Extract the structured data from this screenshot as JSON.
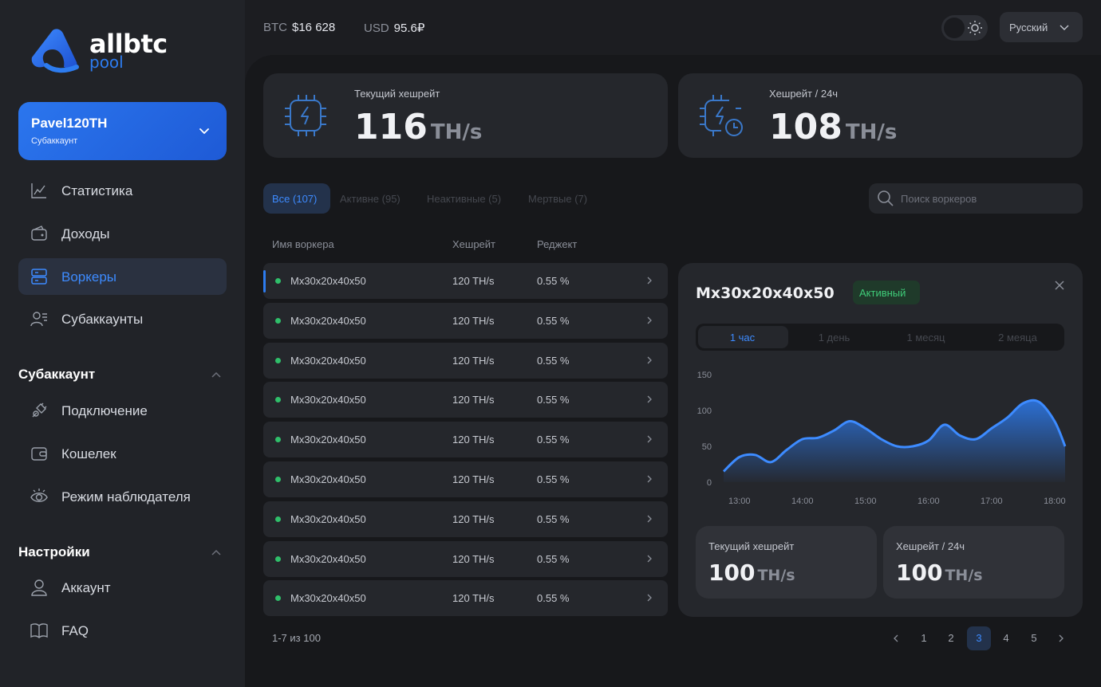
{
  "brand": {
    "name": "allbtc",
    "sub": "pool"
  },
  "account": {
    "name": "Pavel120TH",
    "type": "Субаккаунт"
  },
  "nav": {
    "items": [
      {
        "label": "Статистика",
        "icon": "chart-icon"
      },
      {
        "label": "Доходы",
        "icon": "wallet-icon"
      },
      {
        "label": "Воркеры",
        "icon": "server-icon",
        "active": true
      },
      {
        "label": "Субаккаунты",
        "icon": "users-icon"
      }
    ],
    "sub_section": "Субаккаунт",
    "sub_items": [
      {
        "label": "Подключение",
        "icon": "plug-icon"
      },
      {
        "label": "Кошелек",
        "icon": "wallet-icon"
      },
      {
        "label": "Режим наблюдателя",
        "icon": "eye-icon"
      }
    ],
    "settings_section": "Настройки",
    "settings_items": [
      {
        "label": "Аккаунт",
        "icon": "user-icon"
      },
      {
        "label": "FAQ",
        "icon": "book-icon"
      }
    ]
  },
  "ticker": {
    "btc_label": "BTC",
    "btc_value": "$16 628",
    "usd_label": "USD",
    "usd_value": "95.6₽"
  },
  "language": "Русский",
  "stats": [
    {
      "title": "Текущий хешрейт",
      "value": "116",
      "unit": "TH/s"
    },
    {
      "title": "Хешрейт / 24ч",
      "value": "108",
      "unit": "TH/s"
    }
  ],
  "filters": {
    "all": "Все (107)",
    "active": "Активне (95)",
    "inactive": "Неактивные (5)",
    "dead": "Мертвые (7)"
  },
  "search": {
    "placeholder": "Поиск воркеров"
  },
  "table": {
    "headers": {
      "name": "Имя воркера",
      "hashrate": "Хешрейт",
      "reject": "Реджект"
    },
    "rows": [
      {
        "name": "Mx30x20x40x50",
        "hashrate": "120 TH/s",
        "reject": "0.55 %"
      },
      {
        "name": "Mx30x20x40x50",
        "hashrate": "120 TH/s",
        "reject": "0.55 %"
      },
      {
        "name": "Mx30x20x40x50",
        "hashrate": "120 TH/s",
        "reject": "0.55 %"
      },
      {
        "name": "Mx30x20x40x50",
        "hashrate": "120 TH/s",
        "reject": "0.55 %"
      },
      {
        "name": "Mx30x20x40x50",
        "hashrate": "120 TH/s",
        "reject": "0.55 %"
      },
      {
        "name": "Mx30x20x40x50",
        "hashrate": "120 TH/s",
        "reject": "0.55 %"
      },
      {
        "name": "Mx30x20x40x50",
        "hashrate": "120 TH/s",
        "reject": "0.55 %"
      },
      {
        "name": "Mx30x20x40x50",
        "hashrate": "120 TH/s",
        "reject": "0.55 %"
      },
      {
        "name": "Mx30x20x40x50",
        "hashrate": "120 TH/s",
        "reject": "0.55 %"
      }
    ]
  },
  "pagination": {
    "info": "1-7 из 100",
    "pages": [
      "1",
      "2",
      "3",
      "4",
      "5"
    ],
    "current": "3"
  },
  "detail": {
    "title": "Mx30x20x40x50",
    "status": "Активный",
    "periods": [
      "1 час",
      "1 день",
      "1 месяц",
      "2 меяца"
    ],
    "mini": [
      {
        "title": "Текущий хешрейт",
        "value": "100",
        "unit": "TH/s"
      },
      {
        "title": "Хешрейт / 24ч",
        "value": "100",
        "unit": "TH/s"
      }
    ]
  },
  "colors": {
    "accent": "#2d7cf0",
    "active_green": "#2fbf6a",
    "bg": "#17181b",
    "card": "#25272c"
  },
  "chart_data": {
    "type": "area",
    "x": [
      "12:45",
      "13:00",
      "13:15",
      "13:30",
      "13:45",
      "14:00",
      "14:15",
      "14:30",
      "14:45",
      "15:00",
      "15:15",
      "15:30",
      "15:45",
      "16:00",
      "16:15",
      "16:30",
      "16:45",
      "17:00",
      "17:15",
      "17:30",
      "17:45",
      "18:00",
      "18:10"
    ],
    "series": [
      {
        "values": [
          15,
          35,
          38,
          28,
          45,
          60,
          62,
          72,
          85,
          75,
          60,
          50,
          50,
          58,
          80,
          65,
          60,
          75,
          90,
          110,
          112,
          85,
          50
        ]
      }
    ],
    "tick_labels_x": [
      "13:00",
      "14:00",
      "15:00",
      "16:00",
      "17:00",
      "18:00"
    ],
    "tick_labels_y": [
      "0",
      "50",
      "100",
      "150"
    ],
    "ylim": [
      0,
      150
    ]
  }
}
